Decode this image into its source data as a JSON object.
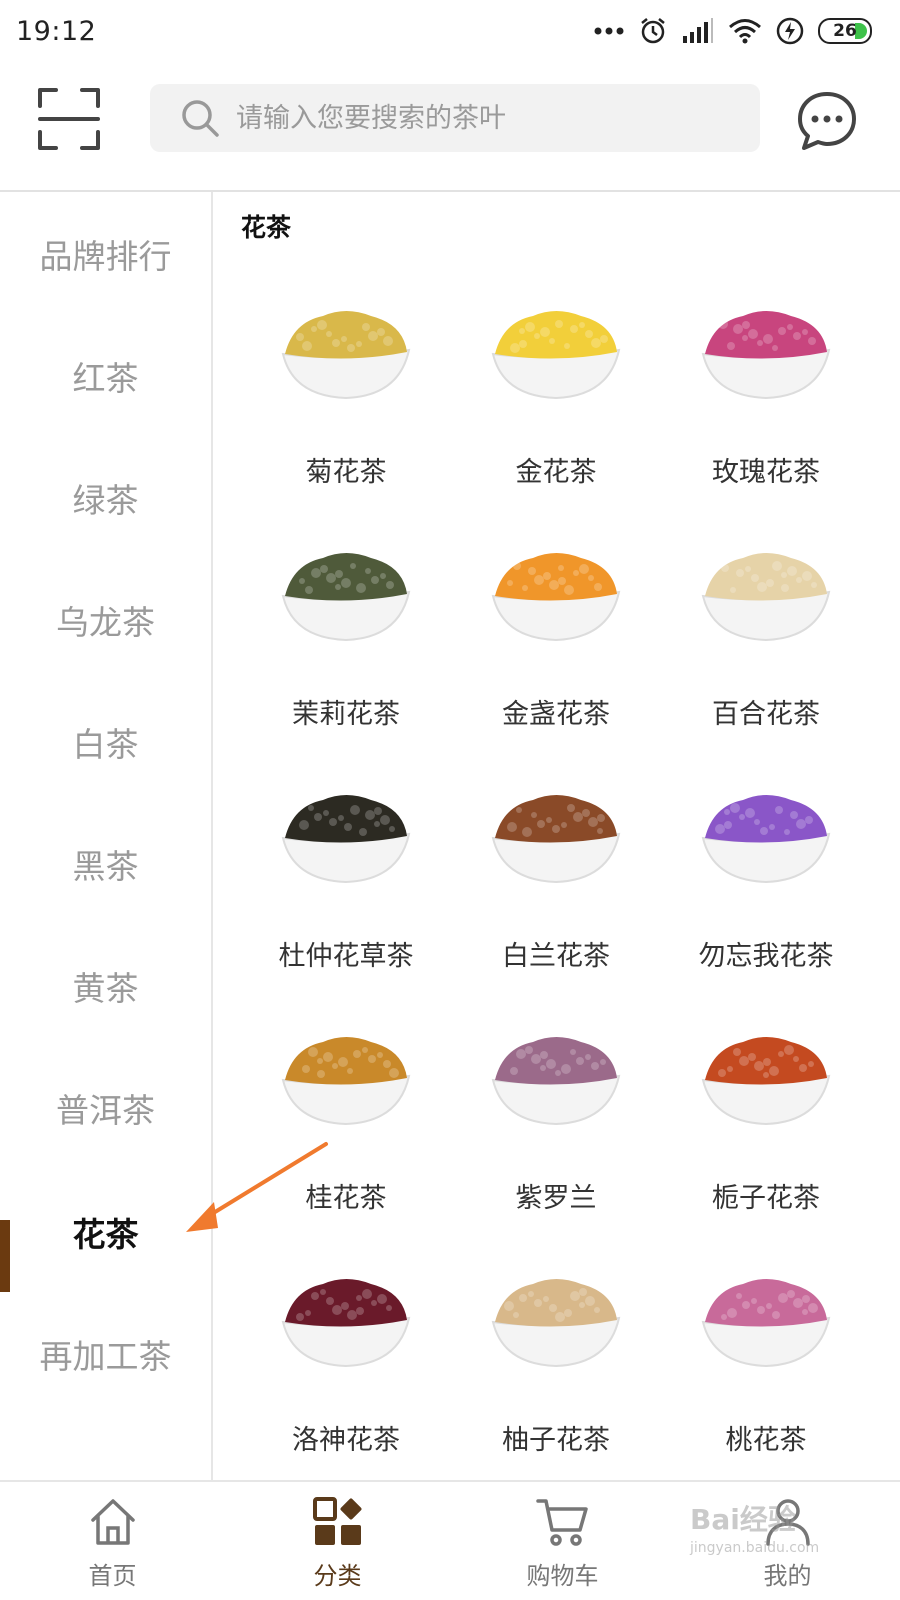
{
  "status_bar": {
    "time": "19:12",
    "battery": "26",
    "icons": [
      "more-dots-icon",
      "alarm-icon",
      "signal-icon",
      "wifi-icon",
      "charging-icon",
      "battery-icon"
    ]
  },
  "header": {
    "scan_icon": "scan-icon",
    "search_placeholder": "请输入您要搜索的茶叶",
    "message_icon": "message-icon"
  },
  "sidebar": {
    "items": [
      {
        "label": "品牌排行"
      },
      {
        "label": "红茶"
      },
      {
        "label": "绿茶"
      },
      {
        "label": "乌龙茶"
      },
      {
        "label": "白茶"
      },
      {
        "label": "黑茶"
      },
      {
        "label": "黄茶"
      },
      {
        "label": "普洱茶"
      },
      {
        "label": "花茶"
      },
      {
        "label": "再加工茶"
      }
    ],
    "active_label": "花茶"
  },
  "content": {
    "section_title": "花茶",
    "products": [
      {
        "name": "菊花茶",
        "color": "#d9b84a"
      },
      {
        "name": "金花茶",
        "color": "#f2cf3a"
      },
      {
        "name": "玫瑰花茶",
        "color": "#c8457e"
      },
      {
        "name": "茉莉花茶",
        "color": "#4f5a3a"
      },
      {
        "name": "金盏花茶",
        "color": "#f0962a"
      },
      {
        "name": "百合花茶",
        "color": "#e6d3a8"
      },
      {
        "name": "杜仲花草茶",
        "color": "#2c2a22"
      },
      {
        "name": "白兰花茶",
        "color": "#8a4a28"
      },
      {
        "name": "勿忘我花茶",
        "color": "#8a56c8"
      },
      {
        "name": "桂花茶",
        "color": "#c9892a"
      },
      {
        "name": "紫罗兰",
        "color": "#9b6a8a"
      },
      {
        "name": "栀子花茶",
        "color": "#c44a20"
      },
      {
        "name": "洛神花茶",
        "color": "#6a1a2a"
      },
      {
        "name": "柚子花茶",
        "color": "#d8b88a"
      },
      {
        "name": "桃花茶",
        "color": "#c86a9a"
      }
    ]
  },
  "tabbar": {
    "tabs": [
      {
        "label": "首页",
        "icon": "home-icon"
      },
      {
        "label": "分类",
        "icon": "category-icon"
      },
      {
        "label": "购物车",
        "icon": "cart-icon"
      },
      {
        "label": "我的",
        "icon": "profile-icon"
      }
    ],
    "active": "分类"
  },
  "watermark": {
    "text": "Bai经验",
    "sub": "jingyan.baidu.com"
  },
  "colors": {
    "accent": "#6b3a10",
    "arrow": "#f07a2e",
    "inactive_text": "#9a9a9a"
  }
}
